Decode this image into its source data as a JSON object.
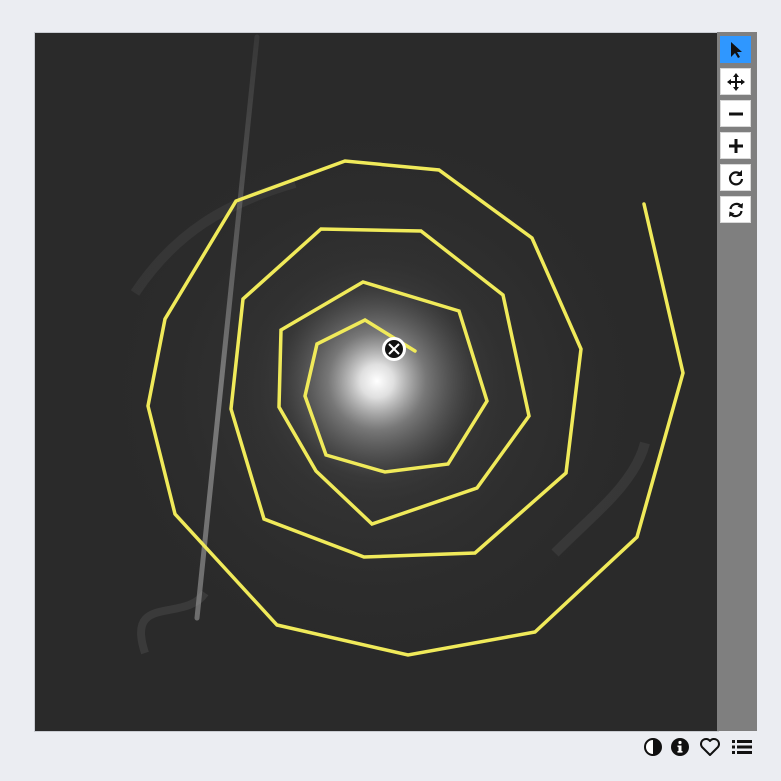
{
  "viewer": {
    "background_color": "#2a2a2a",
    "spiral_color": "#f0ea5a",
    "cursor_marker_icon": "crosshair-circle-x-icon"
  },
  "toolbar": {
    "accent_color": "#2f97ff",
    "buttons": [
      {
        "name": "select",
        "icon": "arrow-pointer-icon",
        "active": true
      },
      {
        "name": "pan",
        "icon": "move-arrows-icon",
        "active": false
      },
      {
        "name": "zoom-out",
        "icon": "minus-icon",
        "active": false
      },
      {
        "name": "zoom-in",
        "icon": "plus-icon",
        "active": false
      },
      {
        "name": "reset",
        "icon": "rotate-cw-icon",
        "active": false
      },
      {
        "name": "refresh",
        "icon": "refresh-cycle-icon",
        "active": false
      }
    ]
  },
  "bottom_bar": {
    "icons": [
      {
        "name": "contrast",
        "icon": "contrast-icon"
      },
      {
        "name": "info",
        "icon": "info-circle-icon"
      },
      {
        "name": "favorite",
        "icon": "heart-outline-icon"
      },
      {
        "name": "menu",
        "icon": "list-icon"
      }
    ]
  }
}
